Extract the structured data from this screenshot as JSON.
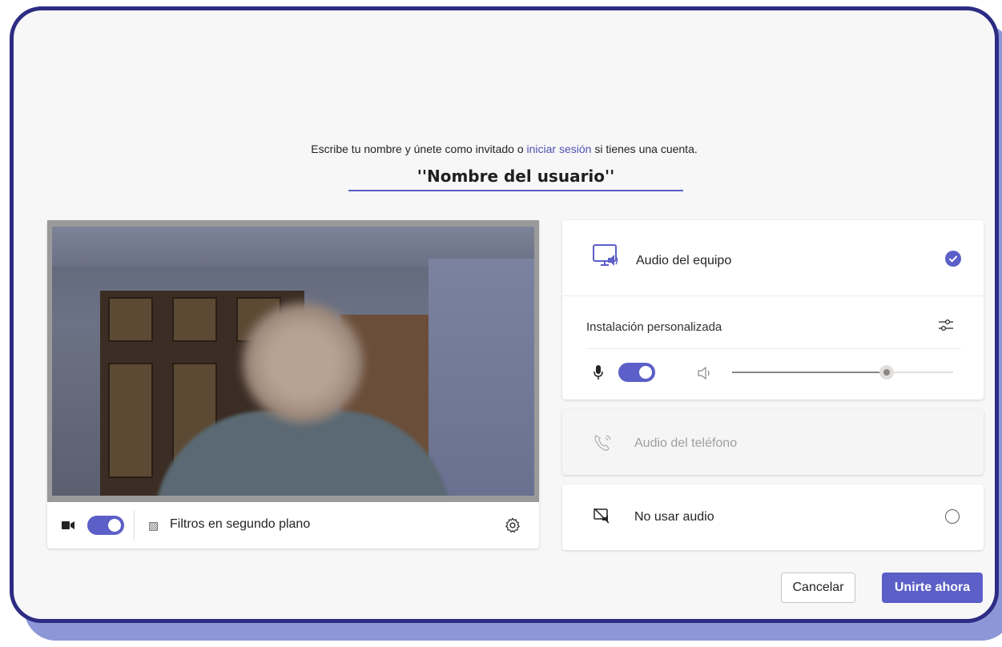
{
  "prompt": {
    "before": "Escribe tu nombre y únete como invitado o ",
    "link": "iniciar sesión",
    "after": " si tienes una cuenta."
  },
  "name_field": {
    "value": "''Nombre del usuario''"
  },
  "video": {
    "filters_label": "Filtros en segundo plano",
    "camera_on": true
  },
  "audio": {
    "computer": {
      "label": "Audio del equipo",
      "selected": true
    },
    "custom_setup": {
      "label": "Instalación personalizada"
    },
    "mic_on": true,
    "volume_percent": 70,
    "phone": {
      "label": "Audio del teléfono",
      "disabled": true
    },
    "none": {
      "label": "No usar audio",
      "selected": false
    }
  },
  "buttons": {
    "cancel": "Cancelar",
    "join": "Unirte ahora"
  },
  "colors": {
    "accent": "#5b5fc7",
    "frame": "#2d2c83",
    "frame_shadow": "#8d97d8"
  },
  "icons": [
    "camera-icon",
    "filters-icon",
    "gear-icon",
    "monitor-speaker-icon",
    "check-icon",
    "sliders-icon",
    "mic-icon",
    "speaker-icon",
    "phone-icon",
    "no-audio-icon"
  ]
}
